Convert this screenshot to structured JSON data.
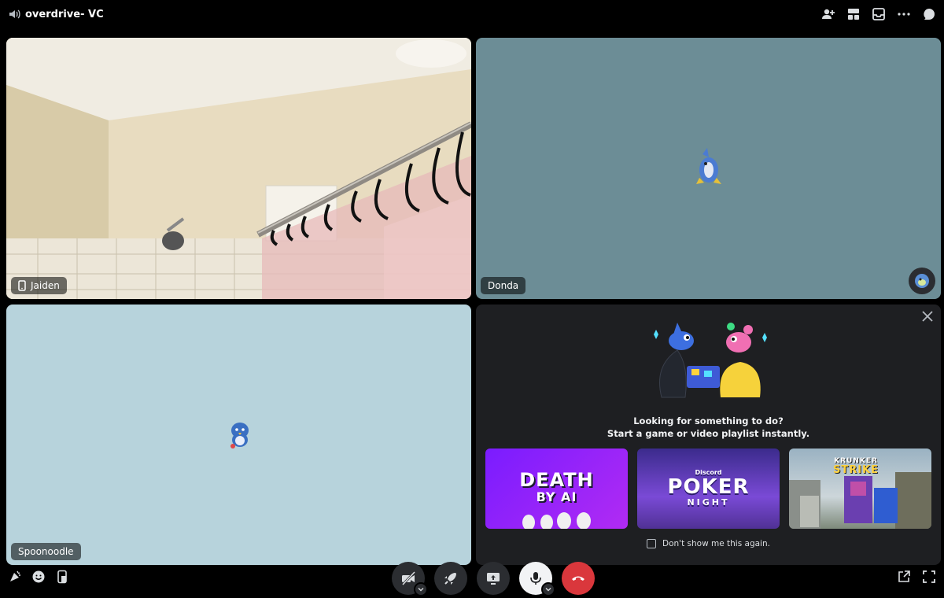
{
  "header": {
    "channel_name": "overdrive- VC"
  },
  "tiles": [
    {
      "name": "Jaiden",
      "device_icon": "phone-icon"
    },
    {
      "name": "Donda"
    },
    {
      "name": "Spoonoodle"
    }
  ],
  "activity": {
    "line1": "Looking for something to do?",
    "line2": "Start a game or video playlist instantly.",
    "cards": [
      {
        "title_line1": "DEATH",
        "title_line2": "BY AI"
      },
      {
        "brand": "Discord",
        "title_line1": "POKER",
        "title_line2": "NIGHT"
      },
      {
        "title_line1": "KRUNKER",
        "title_line2": "STRIKE"
      }
    ],
    "dont_show_label": "Don't show me this again."
  },
  "colors": {
    "end_call": "#da373c",
    "background": "#000000",
    "panel": "#1e1f22"
  }
}
